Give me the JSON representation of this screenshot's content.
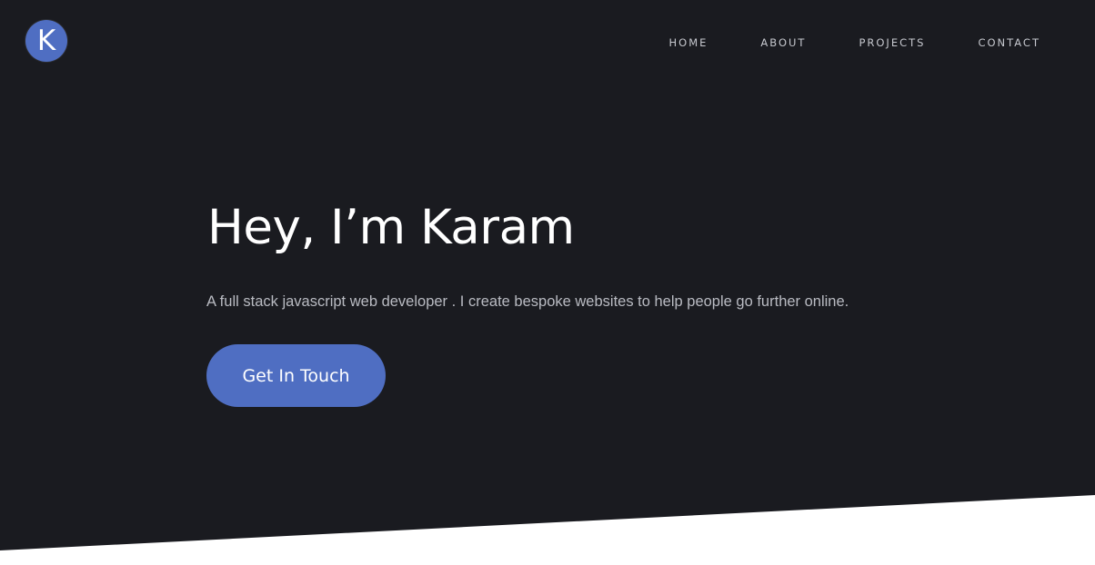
{
  "logo": {
    "letter": "K"
  },
  "nav": {
    "items": [
      {
        "label": "HOME"
      },
      {
        "label": "ABOUT"
      },
      {
        "label": "PROJECTS"
      },
      {
        "label": "CONTACT"
      }
    ]
  },
  "hero": {
    "title": "Hey, I’m Karam",
    "subtitle": "A full stack javascript web developer . I create bespoke websites to help people go further online.",
    "cta_label": "Get In Touch"
  },
  "colors": {
    "background": "#1a1b20",
    "accent": "#4f6ec2",
    "text": "#ffffff",
    "muted_text": "#b9bbc2",
    "below_fold": "#ffffff"
  }
}
